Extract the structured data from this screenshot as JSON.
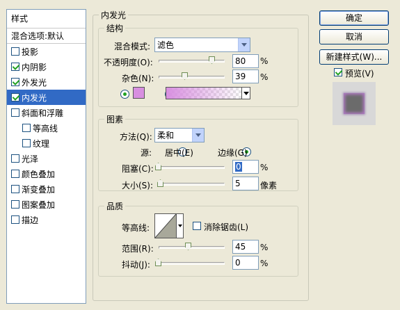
{
  "sidebar": {
    "header": "样式",
    "blend_options": "混合选项:默认",
    "items": [
      {
        "label": "投影",
        "checked": false
      },
      {
        "label": "内阴影",
        "checked": true
      },
      {
        "label": "外发光",
        "checked": true
      },
      {
        "label": "内发光",
        "checked": true,
        "selected": true
      },
      {
        "label": "斜面和浮雕",
        "checked": false
      },
      {
        "label": "等高线",
        "checked": false,
        "indent": true
      },
      {
        "label": "纹理",
        "checked": false,
        "indent": true
      },
      {
        "label": "光泽",
        "checked": false
      },
      {
        "label": "颜色叠加",
        "checked": false
      },
      {
        "label": "渐变叠加",
        "checked": false
      },
      {
        "label": "图案叠加",
        "checked": false
      },
      {
        "label": "描边",
        "checked": false
      }
    ]
  },
  "panel": {
    "title": "内发光",
    "structure": {
      "legend": "结构",
      "blend_mode_label": "混合模式:",
      "blend_mode_value": "滤色",
      "opacity_label": "不透明度(O):",
      "opacity_value": "80",
      "noise_label": "杂色(N):",
      "noise_value": "39",
      "percent": "%",
      "color_swatch": "#d88fe0"
    },
    "elements": {
      "legend": "图素",
      "method_label": "方法(Q):",
      "method_value": "柔和",
      "source_label": "源:",
      "source_center": "居中(E)",
      "source_edge": "边缘(G)",
      "choke_label": "阻塞(C):",
      "choke_value": "0",
      "size_label": "大小(S):",
      "size_value": "5",
      "size_unit": "像素",
      "percent": "%"
    },
    "quality": {
      "legend": "品质",
      "contour_label": "等高线:",
      "antialias_label": "消除锯齿(L)",
      "range_label": "范围(R):",
      "range_value": "45",
      "jitter_label": "抖动(J):",
      "jitter_value": "0",
      "percent": "%"
    }
  },
  "buttons": {
    "ok": "确定",
    "cancel": "取消",
    "new_style": "新建样式(W)...",
    "preview": "预览(V)"
  }
}
